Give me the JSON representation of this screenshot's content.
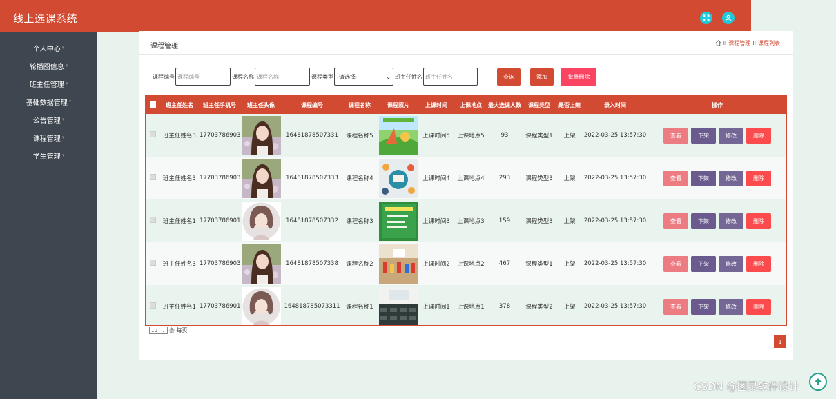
{
  "app": {
    "title": "线上选课系统"
  },
  "topbar": {
    "fullscreen_icon": "fullscreen-icon",
    "user_icon": "user-icon",
    "accent": "#d34a32",
    "icon_color": "#1ec9dc"
  },
  "sidebar": {
    "items": [
      {
        "label": "个人中心"
      },
      {
        "label": "轮播图信息"
      },
      {
        "label": "班主任管理"
      },
      {
        "label": "基础数据管理"
      },
      {
        "label": "公告管理"
      },
      {
        "label": "课程管理"
      },
      {
        "label": "学生管理"
      }
    ]
  },
  "panel": {
    "title": "课程管理",
    "breadcrumb": [
      "课程管理",
      "课程列表"
    ],
    "breadcrumb_sep": "II"
  },
  "search": {
    "course_no_label": "课程编号",
    "course_no_placeholder": "课程编号",
    "course_name_label": "课程名称",
    "course_name_placeholder": "课程名称",
    "course_type_label": "课程类型",
    "course_type_value": "-请选择-",
    "teacher_label": "班主任姓名",
    "teacher_placeholder": "班主任姓名",
    "query_btn": "查询",
    "add_btn": "添加",
    "batch_delete_btn": "批量删除"
  },
  "table": {
    "headers": [
      "班主任姓名",
      "班主任手机号",
      "班主任头像",
      "课程编号",
      "课程名称",
      "课程照片",
      "上课时间",
      "上课地点",
      "最大选课人数",
      "课程类型",
      "是否上架",
      "录入时间",
      "操作"
    ],
    "actions": {
      "view": "查看",
      "unshelf": "下架",
      "edit": "修改",
      "delete": "删除"
    },
    "rows": [
      {
        "teacher": "班主任姓名3",
        "phone": "17703786903",
        "avatar": "avatar-girl-flowers",
        "course_no": "16481878507331",
        "course_name": "课程名称5",
        "photo": "photo-cartoon",
        "time": "上课时间5",
        "place": "上课地点5",
        "max": "93",
        "type": "课程类型1",
        "shelf": "上架",
        "created": "2022-03-25 13:57:30"
      },
      {
        "teacher": "班主任姓名3",
        "phone": "17703786903",
        "avatar": "avatar-girl-flowers",
        "course_no": "16481878507333",
        "course_name": "课程名称4",
        "photo": "photo-team",
        "time": "上课时间4",
        "place": "上课地点4",
        "max": "293",
        "type": "课程类型3",
        "shelf": "上架",
        "created": "2022-03-25 13:57:30"
      },
      {
        "teacher": "班主任姓名1",
        "phone": "17703786901",
        "avatar": "avatar-girl-bob",
        "course_no": "16481878507332",
        "course_name": "课程名称3",
        "photo": "photo-green-slide",
        "time": "上课时间3",
        "place": "上课地点3",
        "max": "159",
        "type": "课程类型3",
        "shelf": "上架",
        "created": "2022-03-25 13:57:30"
      },
      {
        "teacher": "班主任姓名3",
        "phone": "17703786903",
        "avatar": "avatar-girl-flowers",
        "course_no": "16481878507338",
        "course_name": "课程名称2",
        "photo": "photo-classroom-kids",
        "time": "上课时间2",
        "place": "上课地点2",
        "max": "467",
        "type": "课程类型1",
        "shelf": "上架",
        "created": "2022-03-25 13:57:30"
      },
      {
        "teacher": "班主任姓名1",
        "phone": "17703786901",
        "avatar": "avatar-girl-bob",
        "course_no": "164818785073311",
        "course_name": "课程名称1",
        "photo": "photo-lecture-hall",
        "time": "上课时间1",
        "place": "上课地点1",
        "max": "378",
        "type": "课程类型2",
        "shelf": "上架",
        "created": "2022-03-25 13:57:30"
      }
    ]
  },
  "pager": {
    "page_size": "10",
    "per_page_text": "条 每页",
    "current_page": "1"
  },
  "colors": {
    "view": "#ec7b82",
    "unshelf": "#6a5a8e",
    "edit": "#756795",
    "delete": "#fb4b4c",
    "query": "#d34a32",
    "add": "#d34a32",
    "batch": "#fb4461"
  },
  "watermark": "CSDN @图灵软件设计"
}
